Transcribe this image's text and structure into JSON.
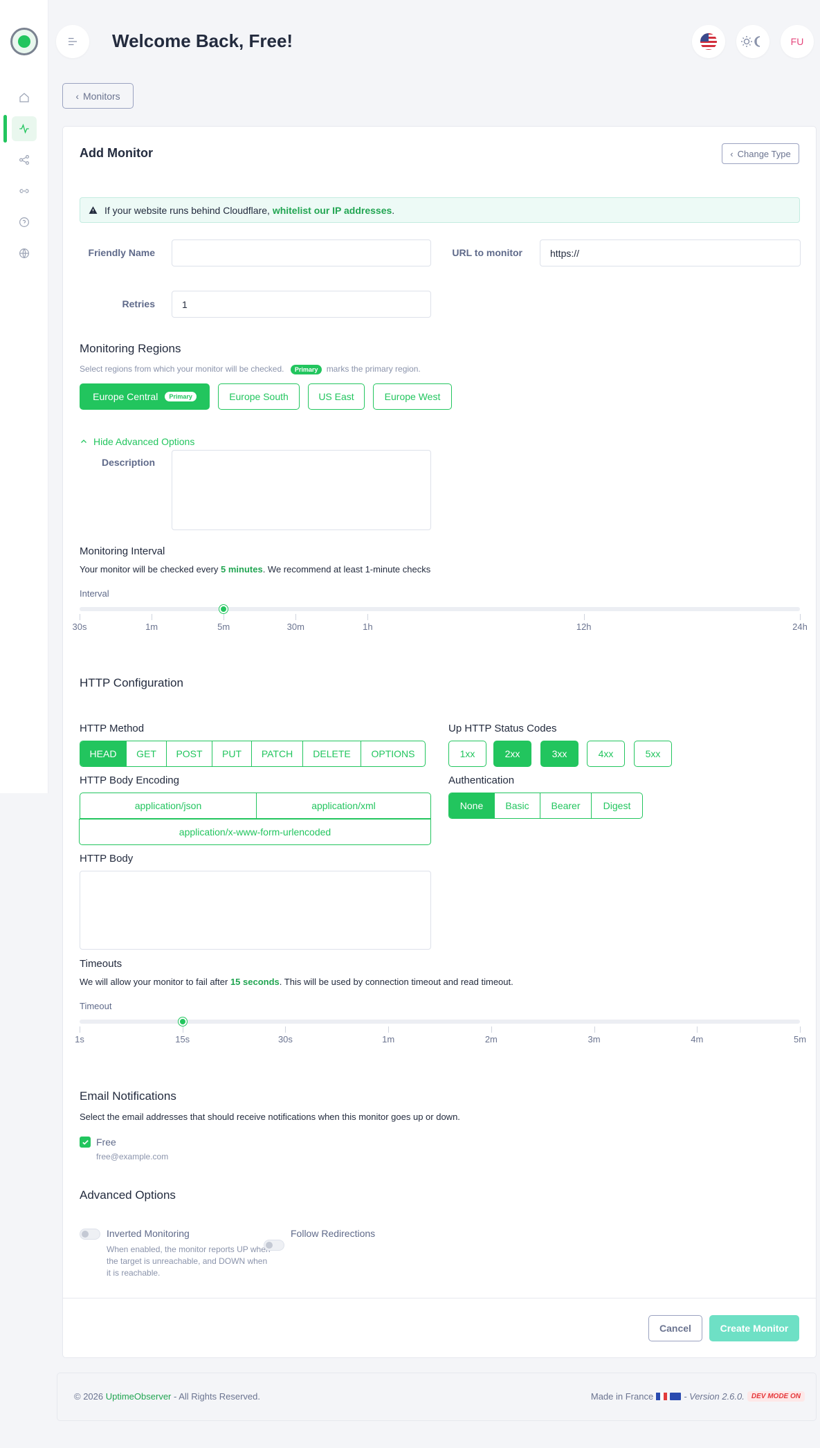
{
  "header": {
    "title": "Welcome Back, Free!",
    "avatar_initials": "FU"
  },
  "nav": {
    "back_label": "Monitors",
    "items": [
      "home-icon",
      "activity-icon",
      "share-icon",
      "link-icon",
      "help-icon",
      "globe-icon"
    ]
  },
  "card": {
    "title": "Add Monitor",
    "change_type_label": "Change Type",
    "alert_text": "If your website runs behind Cloudflare, ",
    "alert_link": "whitelist our IP addresses",
    "alert_end": "."
  },
  "form": {
    "friendly_name_label": "Friendly Name",
    "friendly_name_value": "",
    "url_label": "URL to monitor",
    "url_value": "https://",
    "retries_label": "Retries",
    "retries_value": "1"
  },
  "regions": {
    "title": "Monitoring Regions",
    "hint_before": "Select regions from which your monitor will be checked.",
    "hint_pill": "Primary",
    "hint_after": "marks the primary region.",
    "items": [
      {
        "label": "Europe Central",
        "badge": "Primary",
        "selected": true
      },
      {
        "label": "Europe South",
        "badge": "",
        "selected": false
      },
      {
        "label": "US East",
        "badge": "",
        "selected": false
      },
      {
        "label": "Europe West",
        "badge": "",
        "selected": false
      }
    ]
  },
  "advanced_toggle": "Hide Advanced Options",
  "description_label": "Description",
  "interval": {
    "title": "Monitoring Interval",
    "text_before": "Your monitor will be checked every ",
    "value_text": "5 minutes",
    "text_after": ". We recommend at least 1-minute checks",
    "slider_label": "Interval",
    "ticks": [
      "30s",
      "1m",
      "5m",
      "30m",
      "1h",
      "12h",
      "24h"
    ],
    "selected_index": 2
  },
  "http": {
    "title": "HTTP Configuration",
    "method_label": "HTTP Method",
    "methods": [
      "HEAD",
      "GET",
      "POST",
      "PUT",
      "PATCH",
      "DELETE",
      "OPTIONS"
    ],
    "method_selected": "HEAD",
    "status_label": "Up HTTP Status Codes",
    "status_codes": [
      "1xx",
      "2xx",
      "3xx",
      "4xx",
      "5xx"
    ],
    "status_selected": [
      "2xx",
      "3xx"
    ],
    "encoding_label": "HTTP Body Encoding",
    "encodings": [
      "application/json",
      "application/xml",
      "application/x-www-form-urlencoded"
    ],
    "auth_label": "Authentication",
    "auth_options": [
      "None",
      "Basic",
      "Bearer",
      "Digest"
    ],
    "auth_selected": "None",
    "body_label": "HTTP Body"
  },
  "timeouts": {
    "title": "Timeouts",
    "text_before": "We will allow your monitor to fail after ",
    "value_text": "15 seconds",
    "text_after": ". This will be used by connection timeout and read timeout.",
    "slider_label": "Timeout",
    "ticks": [
      "1s",
      "15s",
      "30s",
      "1m",
      "2m",
      "3m",
      "4m",
      "5m"
    ],
    "selected_index": 1
  },
  "email": {
    "title": "Email Notifications",
    "text": "Select the email addresses that should receive notifications when this monitor goes up or down.",
    "recipient_name": "Free",
    "recipient_email": "free@example.com",
    "checked": true
  },
  "advanced": {
    "title": "Advanced Options",
    "inverted_label": "Inverted Monitoring",
    "inverted_help": "When enabled, the monitor reports UP when the target is unreachable, and DOWN when it is reachable.",
    "follow_label": "Follow Redirections"
  },
  "actions": {
    "cancel": "Cancel",
    "create": "Create Monitor"
  },
  "footer": {
    "copyright": "© 2026 ",
    "brand": "UptimeObserver",
    "rights": " - All Rights Reserved.",
    "made_in": "Made in France",
    "version": "- Version 2.6.0.",
    "dev_mode": "DEV MODE ON"
  },
  "colors": {
    "accent": "#22c55e",
    "create_button": "#6ee0c5",
    "avatar_text": "#e5467c"
  }
}
